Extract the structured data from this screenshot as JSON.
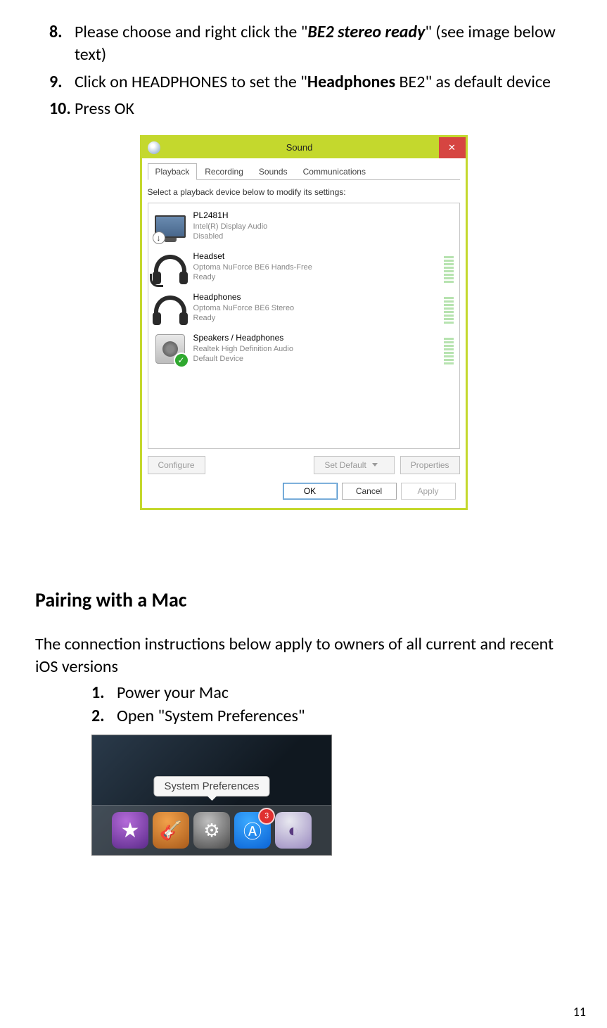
{
  "steps": {
    "n8": "8.",
    "t8a": "Please choose and right click the \"",
    "t8b": "BE2 stereo ready",
    "t8c": "\" (see image below text)",
    "n9": "9.",
    "t9a": "Click on HEADPHONES to set the \"",
    "t9b": "Headphones",
    "t9c": " BE2\" as default device",
    "n10": "10.",
    "t10": "Press OK"
  },
  "sound": {
    "title": "Sound",
    "close": "✕",
    "tabs": [
      "Playback",
      "Recording",
      "Sounds",
      "Communications"
    ],
    "instruction": "Select a playback device below to modify its settings:",
    "devices": [
      {
        "name": "PL2481H",
        "sub": "Intel(R) Display Audio",
        "status": "Disabled",
        "meter": false,
        "icon": "monitor",
        "badge": "disabled"
      },
      {
        "name": "Headset",
        "sub": "Optoma NuForce BE6 Hands-Free",
        "status": "Ready",
        "meter": true,
        "icon": "headset-mic"
      },
      {
        "name": "Headphones",
        "sub": "Optoma NuForce BE6 Stereo",
        "status": "Ready",
        "meter": true,
        "icon": "headset"
      },
      {
        "name": "Speakers / Headphones",
        "sub": "Realtek High Definition Audio",
        "status": "Default Device",
        "meter": true,
        "icon": "speaker",
        "badge": "check"
      }
    ],
    "configure": "Configure",
    "set_default": "Set Default",
    "properties": "Properties",
    "ok": "OK",
    "cancel": "Cancel",
    "apply": "Apply"
  },
  "mac": {
    "heading": "Pairing with a Mac",
    "para": "The connection instructions below apply to owners of all current and recent iOS versions",
    "steps": {
      "n1": "1.",
      "t1": "Power your Mac",
      "n2": "2.",
      "t2": "Open \"System Preferences\""
    },
    "tooltip": "System Preferences",
    "badge": "3"
  },
  "page_number": "11"
}
